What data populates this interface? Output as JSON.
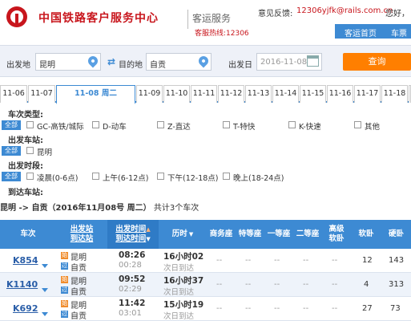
{
  "header": {
    "site_title": "中国铁路客户服务中心",
    "service_title": "客运服务",
    "hotline": "客服热线:12306",
    "feedback_label": "意见反馈:",
    "feedback_email": "12306yjfk@rails.com.cn",
    "greeting": "您好，"
  },
  "nav": {
    "items": [
      "客运首页",
      "车票"
    ]
  },
  "search": {
    "from_label": "出发地",
    "from_value": "昆明",
    "to_label": "目的地",
    "to_value": "自贡",
    "date_label": "出发日",
    "date_value": "2016-11-08",
    "query_label": "查询"
  },
  "date_tabs": [
    "11-06",
    "11-07",
    "11-08 周二",
    "11-09",
    "11-10",
    "11-11",
    "11-12",
    "11-13",
    "11-14",
    "11-15",
    "11-16",
    "11-17",
    "11-18",
    "11-"
  ],
  "active_tab_index": 2,
  "filters": {
    "all_label": "全部",
    "train_type_title": "车次类型:",
    "train_types": [
      "GC-高铁/城际",
      "D-动车",
      "Z-直达",
      "T-特快",
      "K-快速",
      "其他"
    ],
    "depart_station_title": "出发车站:",
    "depart_stations": [
      "昆明"
    ],
    "depart_time_title": "出发时段:",
    "depart_times": [
      "凌晨(0-6点)",
      "上午(6-12点)",
      "下午(12-18点)",
      "晚上(18-24点)"
    ],
    "arrive_station_title": "到达车站:"
  },
  "result": {
    "route": "昆明 -> 自贡（2016年11月08号  周二）",
    "count": "共计3个车次"
  },
  "table": {
    "headers": {
      "train": "车次",
      "station_1": "出发站",
      "station_2": "到达站",
      "time_1": "出发时间",
      "time_2": "到达时间",
      "duration": "历时",
      "business": "商务座",
      "special": "特等座",
      "first": "一等座",
      "second": "二等座",
      "senior_1": "高级",
      "senior_2": "软卧",
      "soft_sleeper": "软卧",
      "hard_sleeper": "硬卧"
    },
    "sort_arrow": "▲",
    "sort_arrow_down": "▼",
    "rows": [
      {
        "train": "K854",
        "from": "昆明",
        "to": "自贡",
        "depart": "08:26",
        "arrive": "00:28",
        "duration": "16小时02",
        "arrive_day": "次日到达",
        "business": "--",
        "special": "--",
        "first": "--",
        "second": "--",
        "senior": "--",
        "soft": "12",
        "hard": "143"
      },
      {
        "train": "K1140",
        "from": "昆明",
        "to": "自贡",
        "depart": "09:52",
        "arrive": "02:29",
        "duration": "16小时37",
        "arrive_day": "次日到达",
        "business": "--",
        "special": "--",
        "first": "--",
        "second": "--",
        "senior": "--",
        "soft": "4",
        "hard": "313"
      },
      {
        "train": "K692",
        "from": "昆明",
        "to": "自贡",
        "depart": "11:42",
        "arrive": "03:01",
        "duration": "15小时19",
        "arrive_day": "次日到达",
        "business": "--",
        "special": "--",
        "first": "--",
        "second": "--",
        "senior": "--",
        "soft": "27",
        "hard": "73"
      }
    ],
    "start_icon_text": "始",
    "pass_icon_text": "过"
  }
}
